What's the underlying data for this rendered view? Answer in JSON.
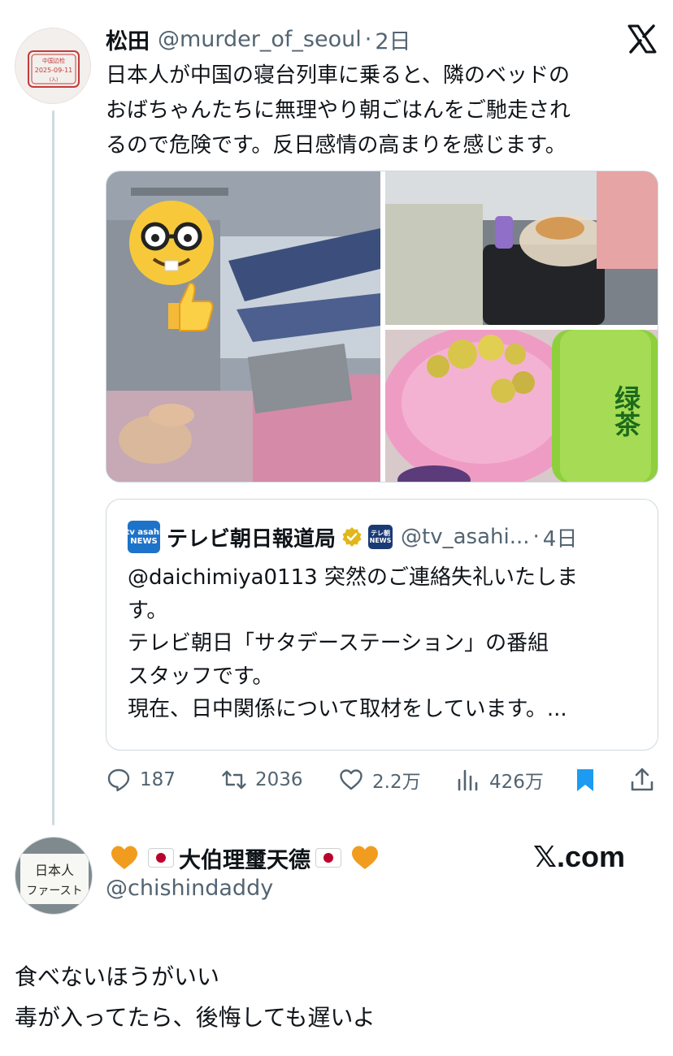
{
  "tweet": {
    "display_name": "松田",
    "handle": "@murder_of_seoul",
    "separator": "·",
    "time": "2日",
    "text_lines": [
      "日本人が中国の寝台列車に乗ると、隣のベッドの",
      "おばちゃんたちに無理やり朝ごはんをご馳走され",
      "るので危険です。反日感情の高まりを感じます。"
    ],
    "avatar_stamp_lines": [
      "中国边检",
      "2025-09-11",
      "(入)"
    ],
    "photo_icon_names": [
      "nerd-face-emoji",
      "thumbs-up-emoji",
      "mosaic-blur"
    ],
    "photo_c_text": "绿茶"
  },
  "quote": {
    "avatar_text": [
      "tv asahi",
      "NEWS"
    ],
    "display_name": "テレビ朝日報道局",
    "affiliate_badge_text": [
      "テレ朝",
      "NEWS"
    ],
    "handle": "@tv_asahi...",
    "separator": "·",
    "time": "4日",
    "text_lines": [
      "@daichimiya0113 突然のご連絡失礼いたしま",
      "す。",
      "テレビ朝日「サタデーステーション」の番組",
      "スタッフです。",
      "現在、日中関係について取材をしています。..."
    ]
  },
  "actions": {
    "replies": "187",
    "retweets": "2036",
    "likes": "2.2万",
    "views": "426万"
  },
  "reply": {
    "avatar_text": [
      "日本人",
      "ファースト"
    ],
    "display_name": "大伯理璽天德",
    "handle": "@chishindaddy",
    "source": "𝕏.com",
    "text_lines": [
      "食べないほうがいい",
      "毒が入ってたら、後悔しても遅いよ"
    ]
  },
  "colors": {
    "text": "#0f1419",
    "secondary": "#536471",
    "accent": "#1d9bf0",
    "border": "#cfd9de",
    "heart_orange": "#f29c1f"
  }
}
